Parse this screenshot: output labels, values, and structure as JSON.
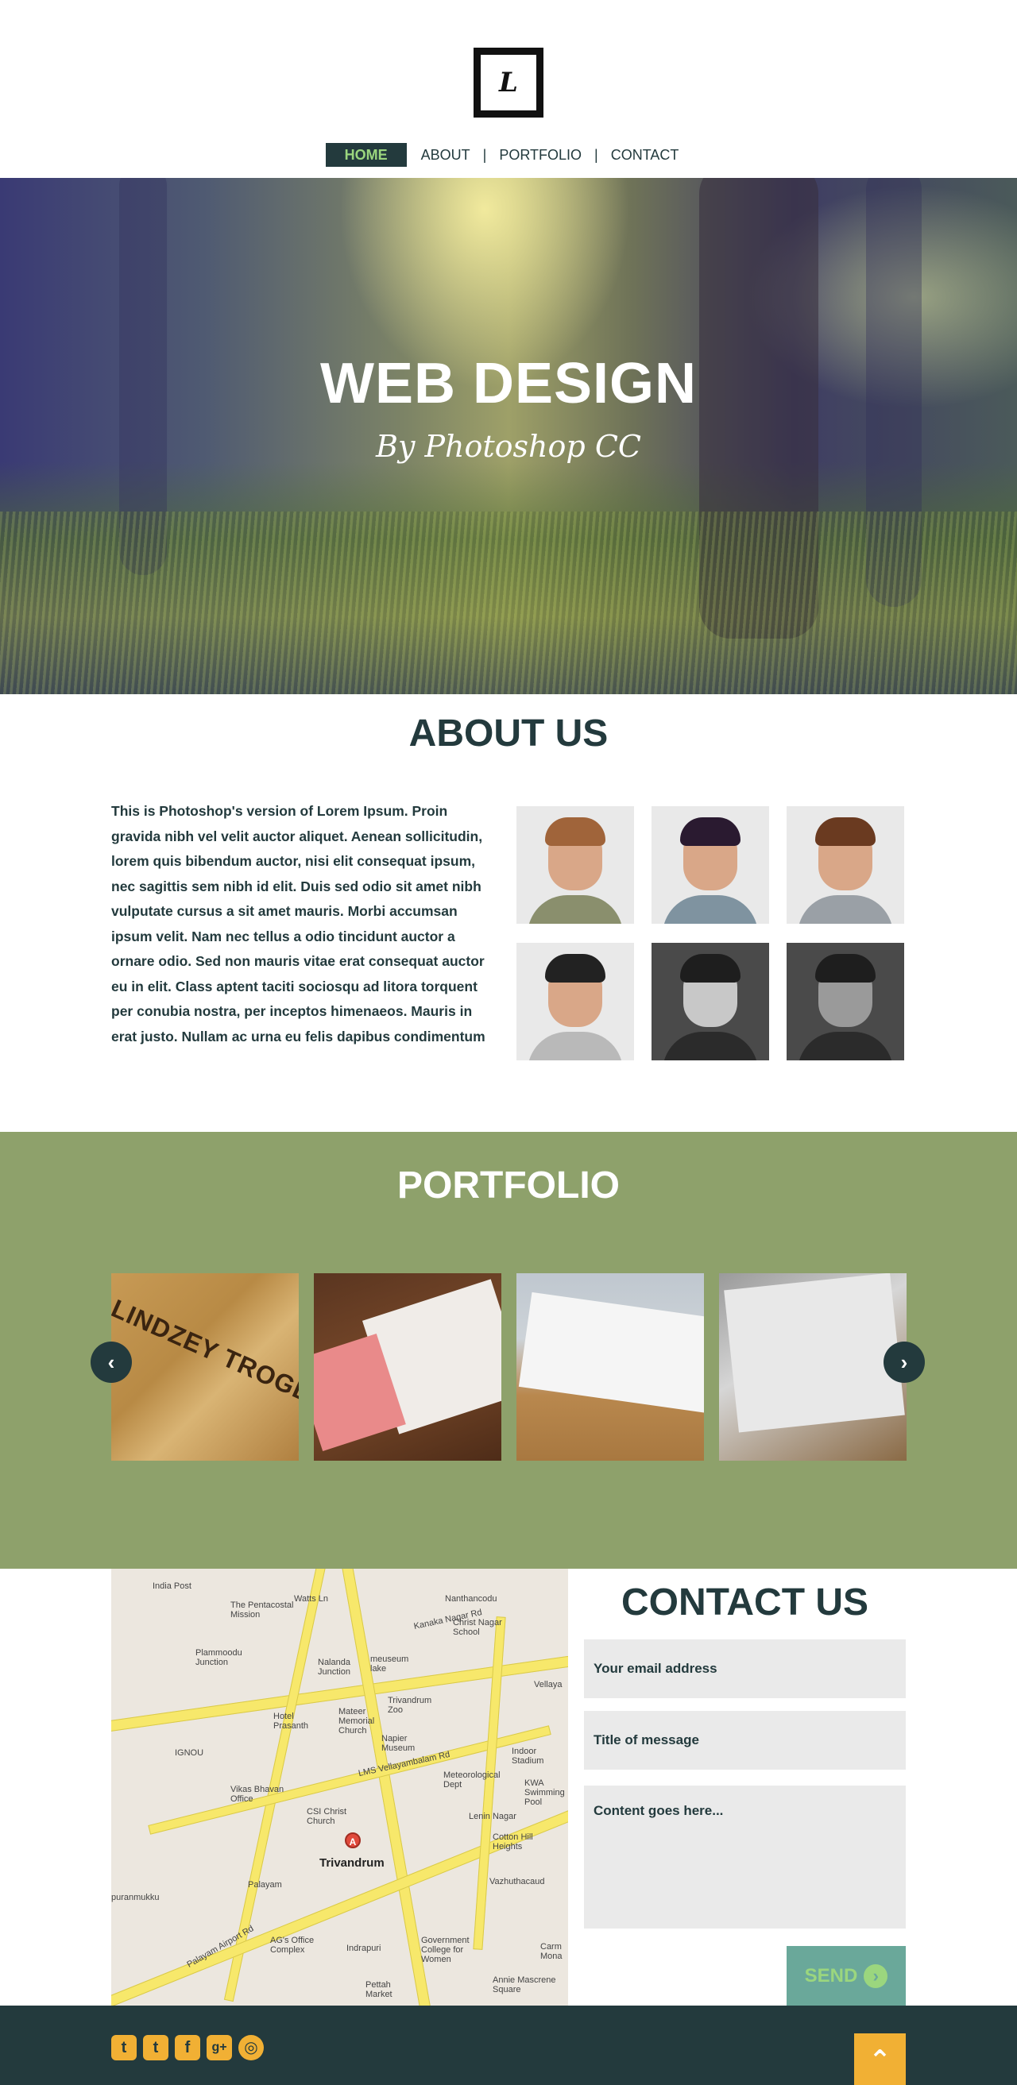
{
  "logo": {
    "letter": "L"
  },
  "nav": [
    {
      "label": "HOME",
      "active": true
    },
    {
      "label": "ABOUT"
    },
    {
      "label": "PORTFOLIO"
    },
    {
      "label": "CONTACT"
    }
  ],
  "nav_separator": "|",
  "hero": {
    "title": "WEB DESIGN",
    "subtitle": "By Photoshop CC"
  },
  "about": {
    "title": "ABOUT US",
    "text": "This is Photoshop's version  of Lorem Ipsum. Proin gravida nibh vel velit auctor aliquet. Aenean sollicitudin, lorem quis bibendum auctor, nisi elit consequat ipsum, nec sagittis sem nibh id elit. Duis sed odio sit amet nibh vulputate cursus a sit amet mauris. Morbi accumsan ipsum velit. Nam nec tellus a odio tincidunt auctor a ornare odio. Sed non  mauris vitae erat consequat auctor eu in elit. Class aptent taciti sociosqu ad litora torquent per conubia nostra, per inceptos himenaeos. Mauris in erat justo. Nullam ac urna eu felis dapibus condimentum"
  },
  "portfolio": {
    "title": "PORTFOLIO",
    "thumb1_text": "LINDZEY TROGDON",
    "prev_icon": "chevron-left-icon",
    "next_icon": "chevron-right-icon"
  },
  "map": {
    "pin": "A",
    "center_label": "Trivandrum",
    "labels": [
      "India Post",
      "The Pentacostal Mission",
      "Watts Ln",
      "Kanaka Nagar Rd",
      "Nanthancodu",
      "Christ Nagar School",
      "Plammoodu Junction",
      "Nalanda Junction",
      "meuseum lake",
      "Trivandrum Zoo",
      "Vellaya",
      "Hotel Prasanth",
      "Mateer Memorial Church",
      "Napier Museum",
      "LMS Vellayambalam Rd",
      "Indoor Stadium",
      "IGNOU",
      "Meteorological Dept",
      "Vikas Bhavan Office",
      "KWA Swimming Pool",
      "CSI Christ Church",
      "Lenin Nagar",
      "Cotton Hill Heights",
      "Palayam",
      "Vazhuthacaud",
      "AG's Office Complex",
      "Indrapuri",
      "Government College for Women",
      "Pettah Market",
      "Annie Mascrene Square",
      "puranmukku",
      "Palayam Airport Rd",
      "Carm Mona"
    ]
  },
  "contact": {
    "title": "CONTACT US",
    "email_placeholder": "Your email address",
    "subject_placeholder": "Title of message",
    "content_placeholder": "Content goes here...",
    "send_label": "SEND"
  },
  "footer": {
    "social": [
      {
        "icon": "twitter-icon",
        "glyph": "t"
      },
      {
        "icon": "tumblr-icon",
        "glyph": "t"
      },
      {
        "icon": "facebook-icon",
        "glyph": "f"
      },
      {
        "icon": "google-plus-icon",
        "glyph": "g+"
      },
      {
        "icon": "dribbble-icon",
        "glyph": "◎"
      }
    ],
    "to_top_icon": "chevron-up-icon"
  },
  "colors": {
    "dark": "#233a3d",
    "green": "#8ea16b",
    "accent": "#9bd67e",
    "teal": "#6aa89a",
    "yellow": "#f1b034"
  }
}
